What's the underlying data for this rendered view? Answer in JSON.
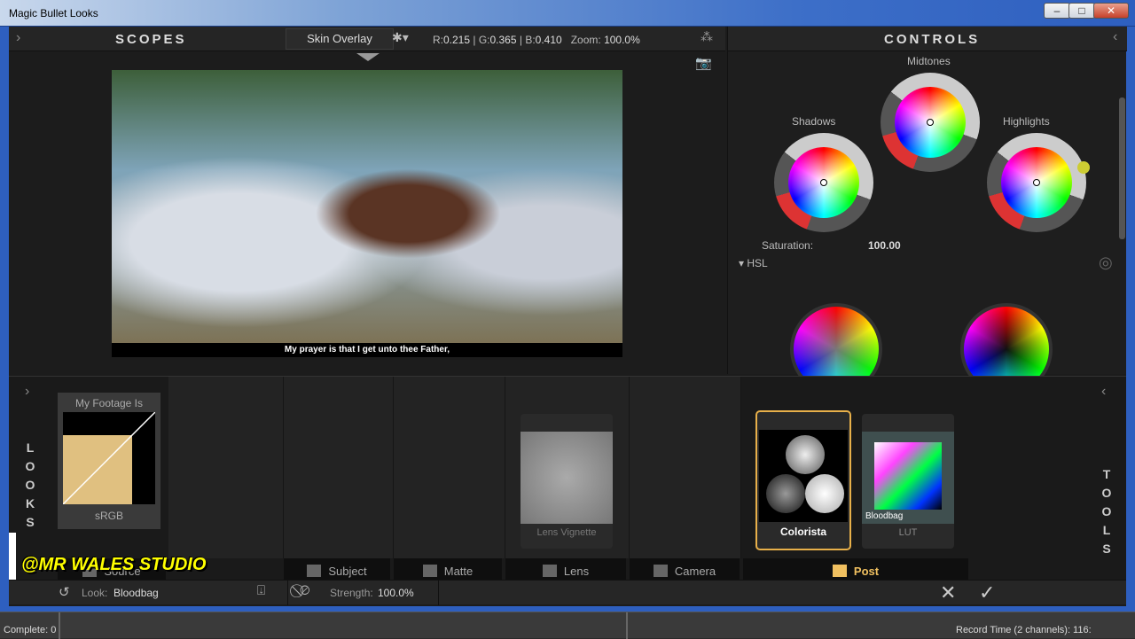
{
  "window": {
    "title": "Magic Bullet Looks",
    "minimize": "–",
    "maximize": "□",
    "close": "✕"
  },
  "scopes": {
    "title": "SCOPES",
    "overlay": "Skin Overlay",
    "r_label": "R:",
    "r": "0.215",
    "g_label": "G:",
    "g": "0.365",
    "b_label": "B:",
    "b": "0.410",
    "zoom_label": "Zoom:",
    "zoom": "100.0%"
  },
  "viewer": {
    "subtitle": "My prayer is that I get unto thee Father,"
  },
  "controls": {
    "title": "CONTROLS",
    "midtones": "Midtones",
    "shadows": "Shadows",
    "highlights": "Highlights",
    "saturation_label": "Saturation:",
    "saturation": "100.00",
    "hsl": "HSL"
  },
  "looks": {
    "label": [
      "L",
      "O",
      "O",
      "K",
      "S"
    ],
    "footage_title": "My Footage Is",
    "footage_sub": "sRGB"
  },
  "tools": {
    "label": [
      "T",
      "O",
      "O",
      "L",
      "S"
    ],
    "lens_vignette": "Lens Vignette",
    "colorista": "Colorista",
    "lut": "LUT",
    "lut_name": "Bloodbag"
  },
  "tabs": {
    "source": "Source",
    "subject": "Subject",
    "matte": "Matte",
    "lens": "Lens",
    "camera": "Camera",
    "post": "Post"
  },
  "watermark": "@MR WALES STUDIO",
  "bottom": {
    "look_label": "Look:",
    "look": "Bloodbag",
    "strength_label": "Strength:",
    "strength": "100.0%",
    "cancel": "✕",
    "ok": "✓"
  },
  "status": {
    "left": "Complete: 0",
    "right": "Record Time (2 channels): 116:"
  },
  "colors": {
    "accent": "#e8b04a",
    "post": "#f0c060"
  }
}
